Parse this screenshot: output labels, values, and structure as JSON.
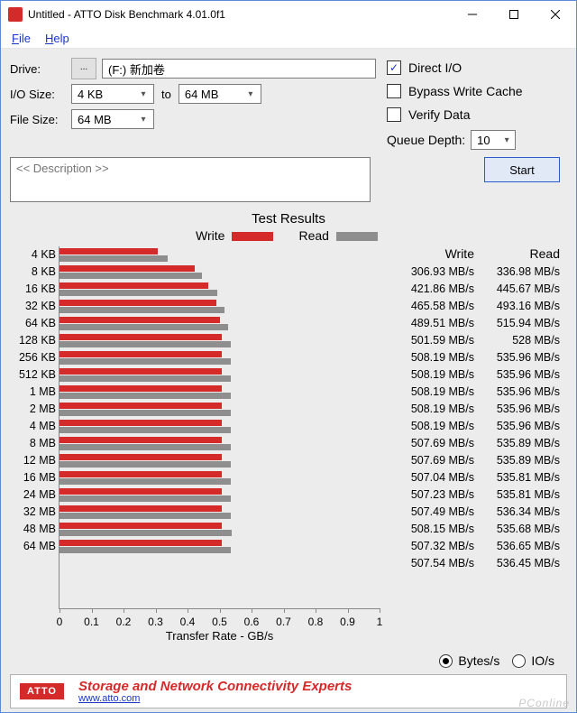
{
  "window": {
    "title": "Untitled - ATTO Disk Benchmark 4.01.0f1",
    "menu": {
      "file": "File",
      "help": "Help"
    }
  },
  "config": {
    "drive_label": "Drive:",
    "drive_value": "(F:) 新加卷",
    "browse": "...",
    "io_label": "I/O Size:",
    "io_from": "4 KB",
    "io_to_label": "to",
    "io_to": "64 MB",
    "fs_label": "File Size:",
    "fs_value": "64 MB",
    "direct_io": "Direct I/O",
    "bypass": "Bypass Write Cache",
    "verify": "Verify Data",
    "qd_label": "Queue Depth:",
    "qd_value": "10",
    "desc_placeholder": "<< Description >>",
    "start": "Start"
  },
  "results": {
    "title": "Test Results",
    "legend_write": "Write",
    "legend_read": "Read",
    "hdr_write": "Write",
    "hdr_read": "Read",
    "xlabel": "Transfer Rate - GB/s",
    "ticks": [
      "0",
      "0.1",
      "0.2",
      "0.3",
      "0.4",
      "0.5",
      "0.6",
      "0.7",
      "0.8",
      "0.9",
      "1"
    ],
    "unit": "MB/s"
  },
  "footer": {
    "bytes": "Bytes/s",
    "ios": "IO/s"
  },
  "brand": {
    "logo": "ATTO",
    "tag": "Storage and Network Connectivity Experts",
    "url": "www.atto.com"
  },
  "watermark": "PConline",
  "chart_data": {
    "type": "bar",
    "orientation": "horizontal",
    "xlabel": "Transfer Rate - GB/s",
    "xlim": [
      0,
      1
    ],
    "xticks": [
      0,
      0.1,
      0.2,
      0.3,
      0.4,
      0.5,
      0.6,
      0.7,
      0.8,
      0.9,
      1
    ],
    "categories": [
      "4 KB",
      "8 KB",
      "16 KB",
      "32 KB",
      "64 KB",
      "128 KB",
      "256 KB",
      "512 KB",
      "1 MB",
      "2 MB",
      "4 MB",
      "8 MB",
      "12 MB",
      "16 MB",
      "24 MB",
      "32 MB",
      "48 MB",
      "64 MB"
    ],
    "series": [
      {
        "name": "Write",
        "color": "#d42a2a",
        "values": [
          306.93,
          421.86,
          465.58,
          489.51,
          501.59,
          508.19,
          508.19,
          508.19,
          508.19,
          508.19,
          507.69,
          507.69,
          507.04,
          507.23,
          507.49,
          508.15,
          507.32,
          507.54
        ]
      },
      {
        "name": "Read",
        "color": "#8e8e8e",
        "values": [
          336.98,
          445.67,
          493.16,
          515.94,
          528,
          535.96,
          535.96,
          535.96,
          535.96,
          535.96,
          535.89,
          535.89,
          535.81,
          535.81,
          536.34,
          535.68,
          536.65,
          536.45
        ]
      }
    ],
    "value_format": {
      "decimals": 2,
      "exceptions": {
        "4": {
          "read": 0
        }
      }
    }
  }
}
